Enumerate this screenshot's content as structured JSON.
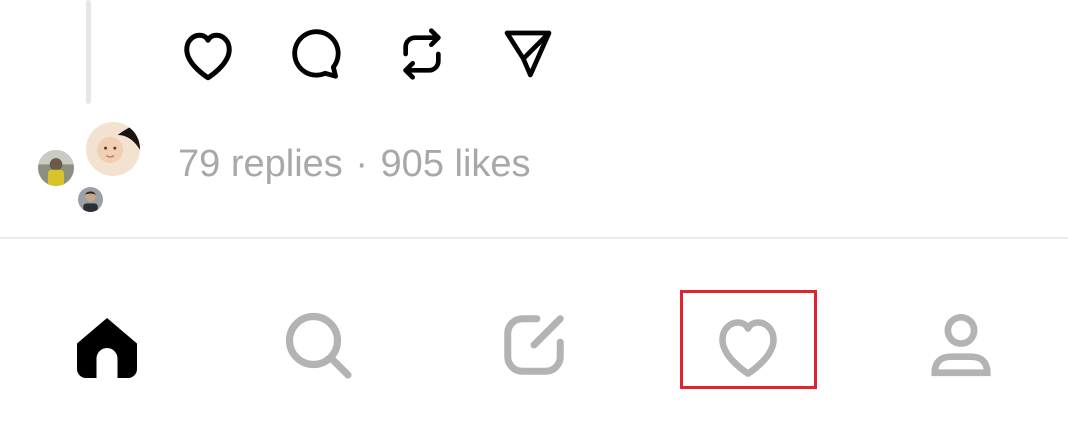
{
  "post": {
    "actions": [
      {
        "name": "like",
        "icon": "heart-icon"
      },
      {
        "name": "reply",
        "icon": "comment-icon"
      },
      {
        "name": "repost",
        "icon": "repost-icon"
      },
      {
        "name": "share",
        "icon": "send-icon"
      }
    ],
    "stats": {
      "replies": "79 replies",
      "separator": "·",
      "likes": "905 likes"
    }
  },
  "bottom_nav": {
    "items": [
      {
        "name": "home",
        "icon": "home-icon",
        "active": true
      },
      {
        "name": "search",
        "icon": "search-icon",
        "active": false
      },
      {
        "name": "compose",
        "icon": "compose-icon",
        "active": false
      },
      {
        "name": "activity",
        "icon": "heart-icon",
        "active": false,
        "highlighted": true
      },
      {
        "name": "profile",
        "icon": "person-icon",
        "active": false
      }
    ],
    "colors": {
      "active": "#000000",
      "inactive": "#b3b3b3",
      "highlight": "#e0242f"
    }
  }
}
